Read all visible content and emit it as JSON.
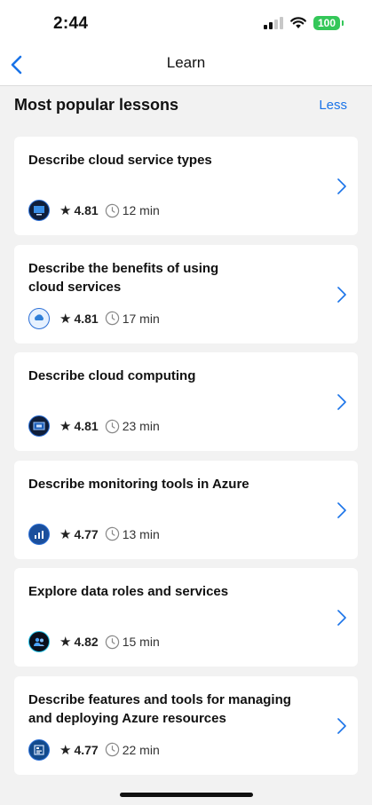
{
  "status_bar": {
    "time": "2:44",
    "battery": "100"
  },
  "nav": {
    "title": "Learn"
  },
  "section": {
    "title": "Most popular lessons",
    "toggle_label": "Less"
  },
  "lessons": [
    {
      "title": "Describe cloud service types",
      "rating": "4.81",
      "duration": "12 min",
      "icon": "cloud-types-module-icon"
    },
    {
      "title": "Describe the benefits of using cloud services",
      "rating": "4.81",
      "duration": "17 min",
      "icon": "cloud-benefits-module-icon"
    },
    {
      "title": "Describe cloud computing",
      "rating": "4.81",
      "duration": "23 min",
      "icon": "cloud-computing-module-icon"
    },
    {
      "title": "Describe monitoring tools in Azure",
      "rating": "4.77",
      "duration": "13 min",
      "icon": "monitoring-module-icon"
    },
    {
      "title": "Explore data roles and services",
      "rating": "4.82",
      "duration": "15 min",
      "icon": "data-roles-module-icon"
    },
    {
      "title": "Describe features and tools for managing and deploying Azure resources",
      "rating": "4.77",
      "duration": "22 min",
      "icon": "azure-tools-module-icon"
    }
  ],
  "colors": {
    "accent": "#1a73e8",
    "battery": "#34c759",
    "background": "#f2f2f2"
  }
}
